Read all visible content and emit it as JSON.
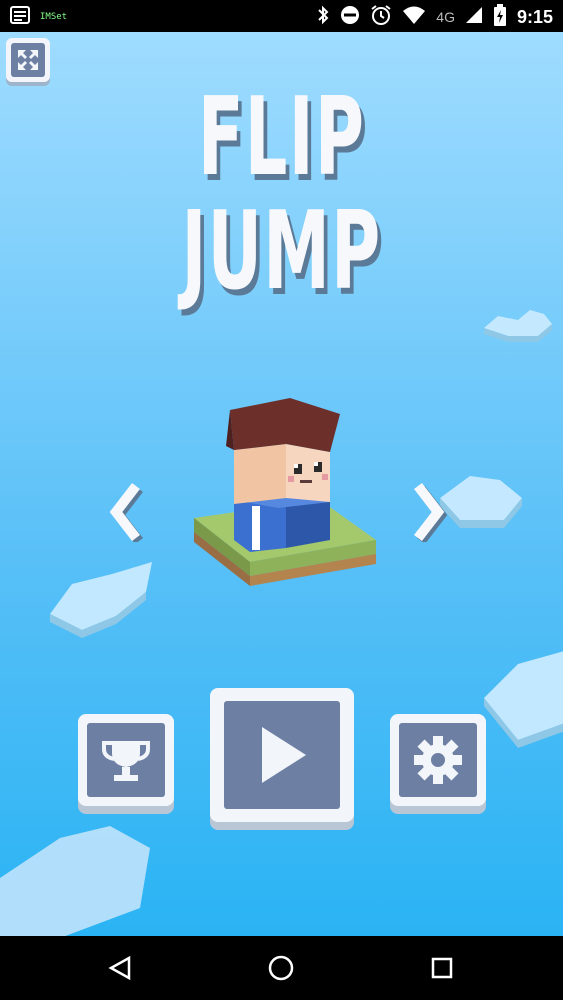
{
  "status_bar": {
    "time": "9:15",
    "network": "4G",
    "app_badge": "IMSet",
    "icons": [
      "notification-icon",
      "app-badge-icon",
      "bluetooth-icon",
      "do-not-disturb-icon",
      "alarm-icon",
      "wifi-icon",
      "signal-icon",
      "battery-charging-icon"
    ]
  },
  "game": {
    "title_line1": "FLIP",
    "title_line2": "JUMP",
    "buttons": {
      "fullscreen": "fullscreen-icon",
      "prev_character": "chevron-left-icon",
      "next_character": "chevron-right-icon",
      "leaderboard": "trophy-icon",
      "play": "play-icon",
      "settings": "gear-icon"
    },
    "colors": {
      "sky_top": "#9fdcff",
      "sky_bottom": "#2ab3f4",
      "button_face": "#6e7fa4",
      "button_frame": "#f2f6fb",
      "title": "#f7f8fb",
      "title_shadow": "#5b7a98"
    }
  },
  "nav_bar": {
    "icons": [
      "back-icon",
      "home-icon",
      "recents-icon"
    ]
  }
}
